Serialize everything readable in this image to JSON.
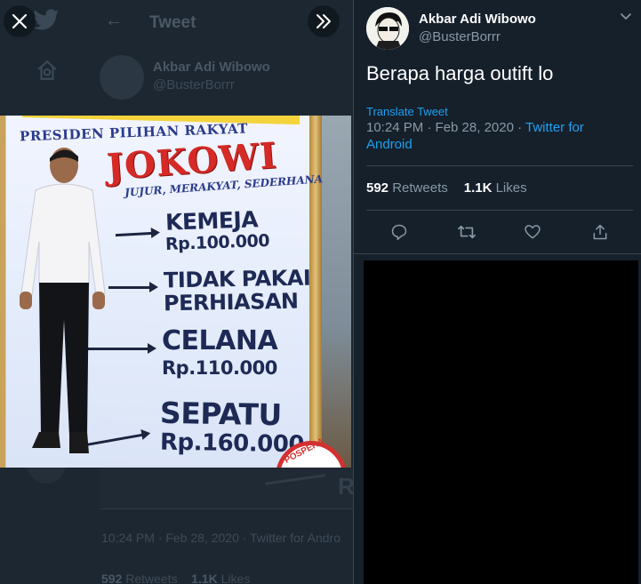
{
  "background": {
    "header_title": "Tweet",
    "author_name": "Akbar Adi Wibowo",
    "author_handle": "@BusterBorrr",
    "time_line": "10:24 PM · Feb 28, 2020 · Twitter for Andro",
    "retweets_count": "592",
    "retweets_label": "Retweets",
    "likes_count": "1.1K",
    "likes_label": "Likes"
  },
  "photo": {
    "banner_line1": "PRESIDEN PILIHAN RAKYAT",
    "banner_name": "JOKOWI",
    "banner_tagline": "JUJUR, MERAKYAT, SEDERHANA",
    "item1_title": "KEMEJA",
    "item1_price": "Rp.100.000",
    "item2_line1": "TIDAK PAKAI",
    "item2_line2": "PERHIASAN",
    "item3_title": "CELANA",
    "item3_price": "Rp.110.000",
    "item4_title": "SEPATU",
    "item4_price": "Rp.160.000",
    "seal_text": "POSPERA"
  },
  "overlay": {
    "close_icon": "close-icon",
    "expand_icon": "chevrons-right-icon"
  },
  "tweet": {
    "author_name": "Akbar Adi Wibowo",
    "author_handle": "@BusterBorrr",
    "text": "Berapa harga outift lo",
    "translate_label": "Translate Tweet",
    "timestamp": "10:24 PM · Feb 28, 2020 · ",
    "source": "Twitter for Android",
    "retweets_count": "592",
    "retweets_label": "Retweets",
    "likes_count": "1.1K",
    "likes_label": "Likes",
    "actions": [
      "reply-icon",
      "retweet-icon",
      "like-icon",
      "share-icon"
    ]
  },
  "colors": {
    "background": "#15202b",
    "accent": "#1da1f2",
    "secondary_text": "#8899a6",
    "divider": "#38444d"
  }
}
